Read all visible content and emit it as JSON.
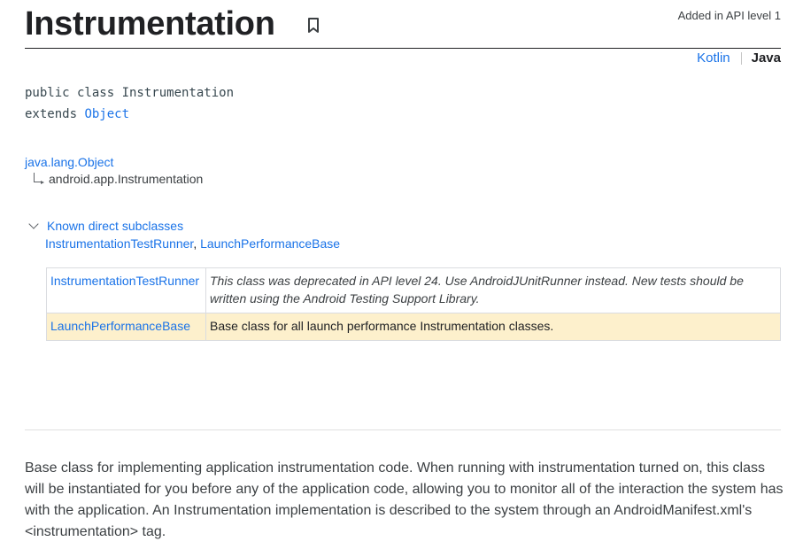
{
  "header": {
    "title": "Instrumentation",
    "api_level": "Added in API level 1",
    "bookmark_icon": "bookmark-icon"
  },
  "lang_switch": {
    "kotlin": "Kotlin",
    "java": "Java",
    "active": "Java"
  },
  "declaration": {
    "line1": "public class Instrumentation",
    "extends_kw": "extends ",
    "extends_link": "Object"
  },
  "hierarchy": {
    "parent": "java.lang.Object",
    "child": "android.app.Instrumentation"
  },
  "subclasses": {
    "toggle_label": "Known direct subclasses",
    "link1": "InstrumentationTestRunner",
    "separator": ", ",
    "link2": "LaunchPerformanceBase",
    "rows": [
      {
        "name": "InstrumentationTestRunner",
        "desc_a": "This class was deprecated in API level 24. Use ",
        "desc_link1": "AndroidJUnitRunner",
        "desc_b": " instead. New tests should be written using the ",
        "desc_link2": "Android Testing Support Library",
        "desc_c": "."
      },
      {
        "name": "LaunchPerformanceBase",
        "desc": "Base class for all launch performance Instrumentation classes."
      }
    ]
  },
  "description": "Base class for implementing application instrumentation code. When running with instrumentation turned on, this class will be instantiated for you before any of the application code, allowing you to monitor all of the interaction the system has with the application. An Instrumentation implementation is described to the system through an AndroidManifest.xml's <instrumentation> tag.",
  "colors": {
    "link": "#1a73e8",
    "highlight_row": "#fdf0cc",
    "text": "#202124"
  }
}
